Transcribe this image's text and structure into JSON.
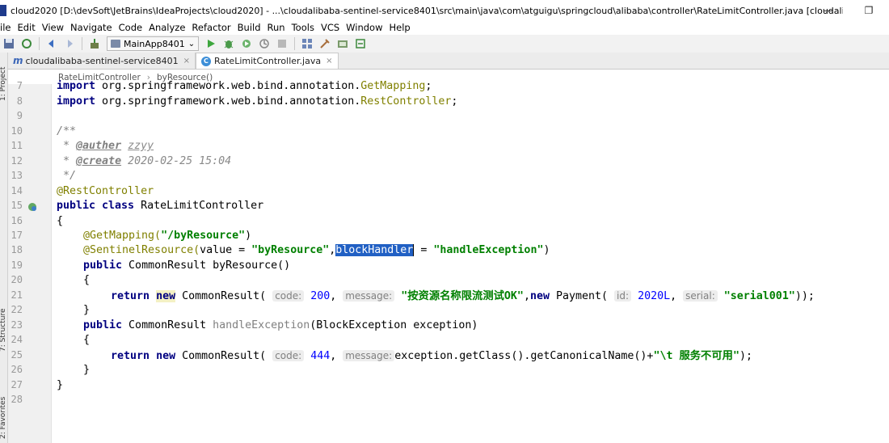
{
  "window": {
    "title": "cloud2020 [D:\\devSoft\\JetBrains\\IdeaProjects\\cloud2020] - ...\\cloudalibaba-sentinel-service8401\\src\\main\\java\\com\\atguigu\\springcloud\\alibaba\\controller\\RateLimitController.java [cloudalibaba-sentinel-se...",
    "minimize": "—",
    "restore": "❐"
  },
  "menu": [
    "ile",
    "Edit",
    "View",
    "Navigate",
    "Code",
    "Analyze",
    "Refactor",
    "Build",
    "Run",
    "Tools",
    "VCS",
    "Window",
    "Help"
  ],
  "toolbar": {
    "run_config": "MainApp8401",
    "run_config_arrow": "⌄"
  },
  "tabs": [
    {
      "icon": "m",
      "label": "cloudalibaba-sentinel-service8401",
      "close": "×"
    },
    {
      "icon": "C",
      "label": "RateLimitController.java",
      "close": "×"
    }
  ],
  "side_labels": {
    "project": "1: Project",
    "structure": "7: Structure",
    "favorites": "2: Favorites"
  },
  "breadcrumb": [
    "RateLimitController",
    "byResource()"
  ],
  "line_numbers": [
    "7",
    "8",
    "9",
    "10",
    "11",
    "12",
    "13",
    "14",
    "15",
    "16",
    "17",
    "18",
    "19",
    "20",
    "21",
    "22",
    "23",
    "24",
    "25",
    "26",
    "27",
    "28"
  ],
  "code": {
    "l7_kw": "import",
    "l7_rest": " org.springframework.web.bind.annotation.",
    "l7_cls": "GetMapping",
    "l7_end": ";",
    "l8_kw": "import",
    "l8_rest": " org.springframework.web.bind.annotation.",
    "l8_cls": "RestController",
    "l8_end": ";",
    "l10": "/**",
    "l11_star": " * ",
    "l11_tag": "@auther",
    "l11_val": "zzyy",
    "l12_star": " * ",
    "l12_tag": "@create",
    "l12_val": "2020-02-25 15:04",
    "l13": " */",
    "l14": "@RestController",
    "l15_kw": "public class",
    "l15_rest": " RateLimitController",
    "l16": "{",
    "l17_ann": "@GetMapping(",
    "l17_str": "\"/byResource\"",
    "l17_end": ")",
    "l18_ann": "@SentinelResource(",
    "l18_a": "value = ",
    "l18_str1": "\"byResource\"",
    "l18_comma": ",",
    "l18_sel": "blockHandler",
    "l18_eq": "= ",
    "l18_str2": "\"handleException\"",
    "l18_end": ")",
    "l19_kw": "public",
    "l19_rest": " CommonResult byResource()",
    "l20": "{",
    "l21_kw1": "return",
    "l21_kw2": "new",
    "l21_a": " CommonResult( ",
    "l21_h1": "code:",
    "l21_n1": "200",
    "l21_c1": ", ",
    "l21_h2": "message:",
    "l21_s1": "\"按资源名称限流测试OK\"",
    "l21_c2": ",",
    "l21_kw3": "new",
    "l21_b": " Payment( ",
    "l21_h3": "id:",
    "l21_n2": "2020L",
    "l21_c3": ", ",
    "l21_h4": "serial:",
    "l21_s2": "\"serial001\"",
    "l21_end": "));",
    "l22": "}",
    "l23_kw": "public",
    "l23_a": " CommonResult ",
    "l23_unused": "handleException",
    "l23_b": "(BlockException exception)",
    "l24": "{",
    "l25_kw1": "return",
    "l25_kw2": "new",
    "l25_a": " CommonResult( ",
    "l25_h1": "code:",
    "l25_n1": "444",
    "l25_c1": ", ",
    "l25_h2": "message:",
    "l25_b": "exception.getClass().getCanonicalName()+",
    "l25_s1": "\"\\t 服务不可用\"",
    "l25_end": ");",
    "l26": "}",
    "l27": "}"
  }
}
